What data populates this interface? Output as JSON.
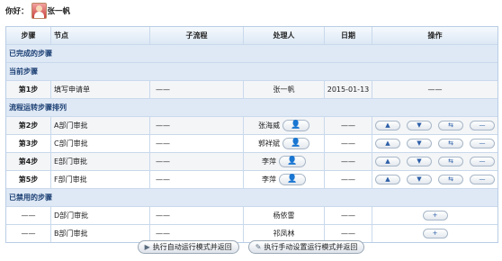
{
  "greeting": {
    "label": "你好：",
    "user": "张一帆"
  },
  "columns": [
    "步骤",
    "节点",
    "子流程",
    "处理人",
    "日期",
    "操作"
  ],
  "sections": {
    "completed": "已完成的步骤",
    "current": "当前步骤",
    "flow": "流程运转步骤排列",
    "disabled": "已禁用的步骤"
  },
  "current_row": {
    "step": "第1步",
    "node": "填写申请单",
    "subflow": "——",
    "handler": "张一帆",
    "date": "2015-01-13",
    "ops": "——"
  },
  "flow_rows": [
    {
      "step": "第2步",
      "node": "A部门审批",
      "subflow": "——",
      "handler": "张海威",
      "date": "——"
    },
    {
      "step": "第3步",
      "node": "C部门审批",
      "subflow": "——",
      "handler": "郭祥斌",
      "date": "——"
    },
    {
      "step": "第4步",
      "node": "E部门审批",
      "subflow": "——",
      "handler": "李萍",
      "date": "——"
    },
    {
      "step": "第5步",
      "node": "F部门审批",
      "subflow": "——",
      "handler": "李萍",
      "date": "——"
    }
  ],
  "disabled_rows": [
    {
      "step": "——",
      "node": "D部门审批",
      "subflow": "——",
      "handler": "杨依雷",
      "date": "——"
    },
    {
      "step": "——",
      "node": "B部门审批",
      "subflow": "——",
      "handler": "祁凤林",
      "date": "——"
    }
  ],
  "icons": {
    "up": "▲",
    "down": "▼",
    "move": "⇆",
    "remove": "—",
    "add": "+",
    "person": "👤"
  },
  "footer": {
    "auto": "执行自动运行模式并返回",
    "manual": "执行手动设置运行模式并返回"
  }
}
